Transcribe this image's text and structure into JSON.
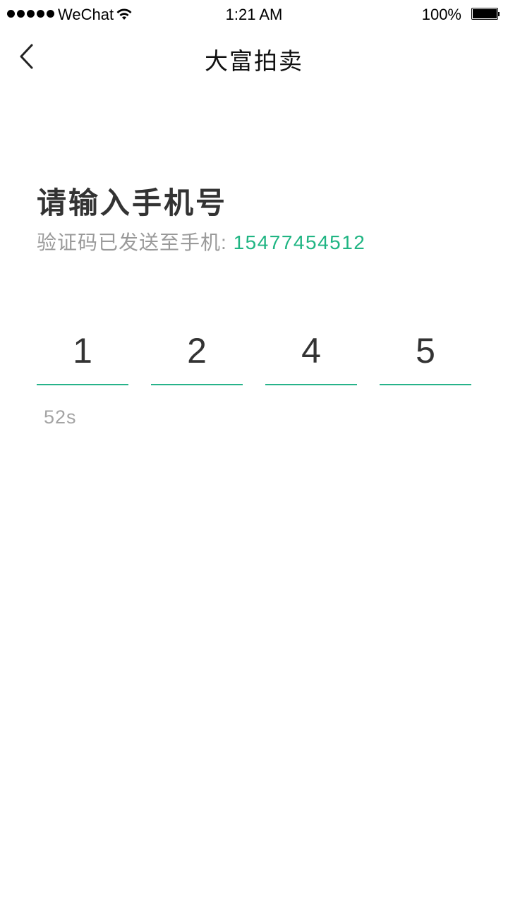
{
  "status_bar": {
    "carrier": "WeChat",
    "time": "1:21 AM",
    "battery": "100%",
    "battery_level": 1.0,
    "signal_bars": 5
  },
  "nav": {
    "title": "大富拍卖",
    "back_icon": "chevron-left-icon"
  },
  "main": {
    "heading": "请输入手机号",
    "sent_label": "验证码已发送至手机: ",
    "phone": "15477454512",
    "code_digits": [
      "1",
      "2",
      "4",
      "5"
    ],
    "countdown": "52s"
  },
  "colors": {
    "accent": "#20b583",
    "underline": "#27b38a",
    "muted_text": "#9a9a9a",
    "heading_text": "#333333"
  }
}
